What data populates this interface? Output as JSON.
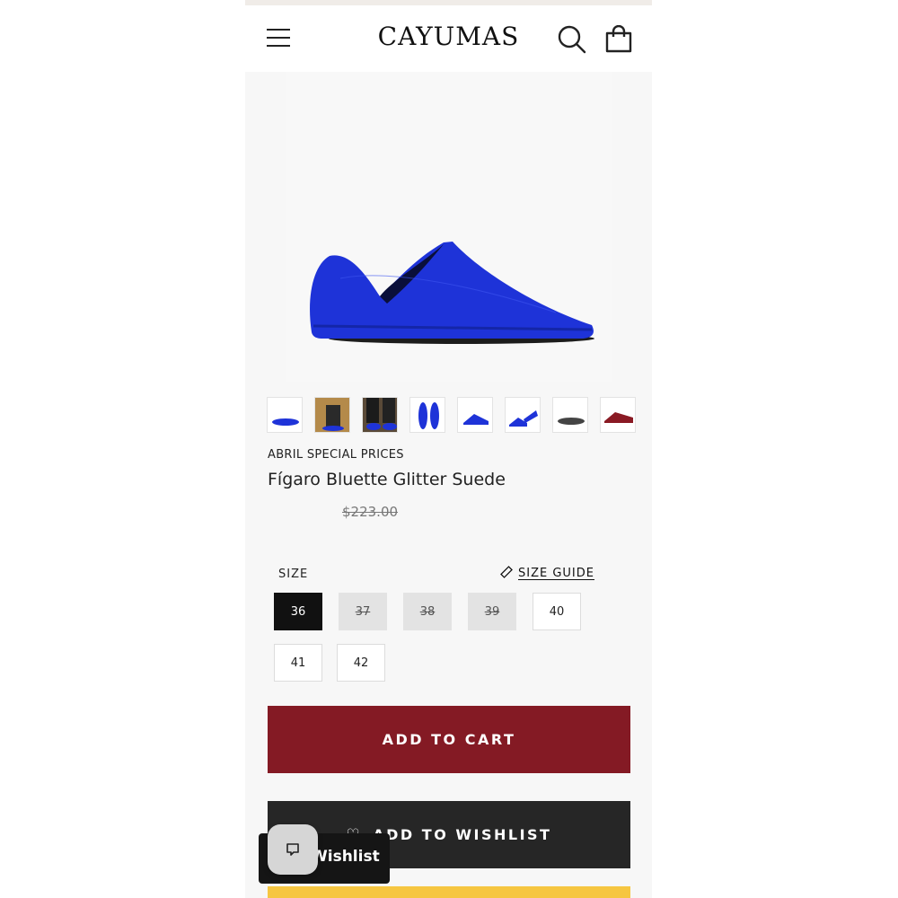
{
  "header": {
    "logo": "CAYUMAS",
    "menu_icon": "hamburger-menu-icon",
    "search_icon": "search-icon",
    "cart_icon": "shopping-bag-icon"
  },
  "product": {
    "promo_label": "ABRIL SPECIAL PRICES",
    "title": "Fígaro Bluette Glitter Suede",
    "compare_price": "$223.00",
    "thumbnail_count": 8
  },
  "sizes": {
    "label": "SIZE",
    "guide_label": "SIZE GUIDE",
    "options": [
      {
        "value": "36",
        "state": "selected"
      },
      {
        "value": "37",
        "state": "sold-out"
      },
      {
        "value": "38",
        "state": "sold-out"
      },
      {
        "value": "39",
        "state": "sold-out"
      },
      {
        "value": "40",
        "state": "available"
      },
      {
        "value": "41",
        "state": "available"
      },
      {
        "value": "42",
        "state": "available"
      }
    ]
  },
  "actions": {
    "add_to_cart": "ADD TO CART",
    "add_to_wishlist": "ADD TO WISHLIST"
  },
  "floating": {
    "wishlist_label": "Wishlist",
    "chat_icon": "chat-icon"
  },
  "colors": {
    "cart_button": "#841a24",
    "wishlist_button": "#262626",
    "shoe_blue": "#1a2fd6",
    "accent_yellow": "#f6c641"
  }
}
